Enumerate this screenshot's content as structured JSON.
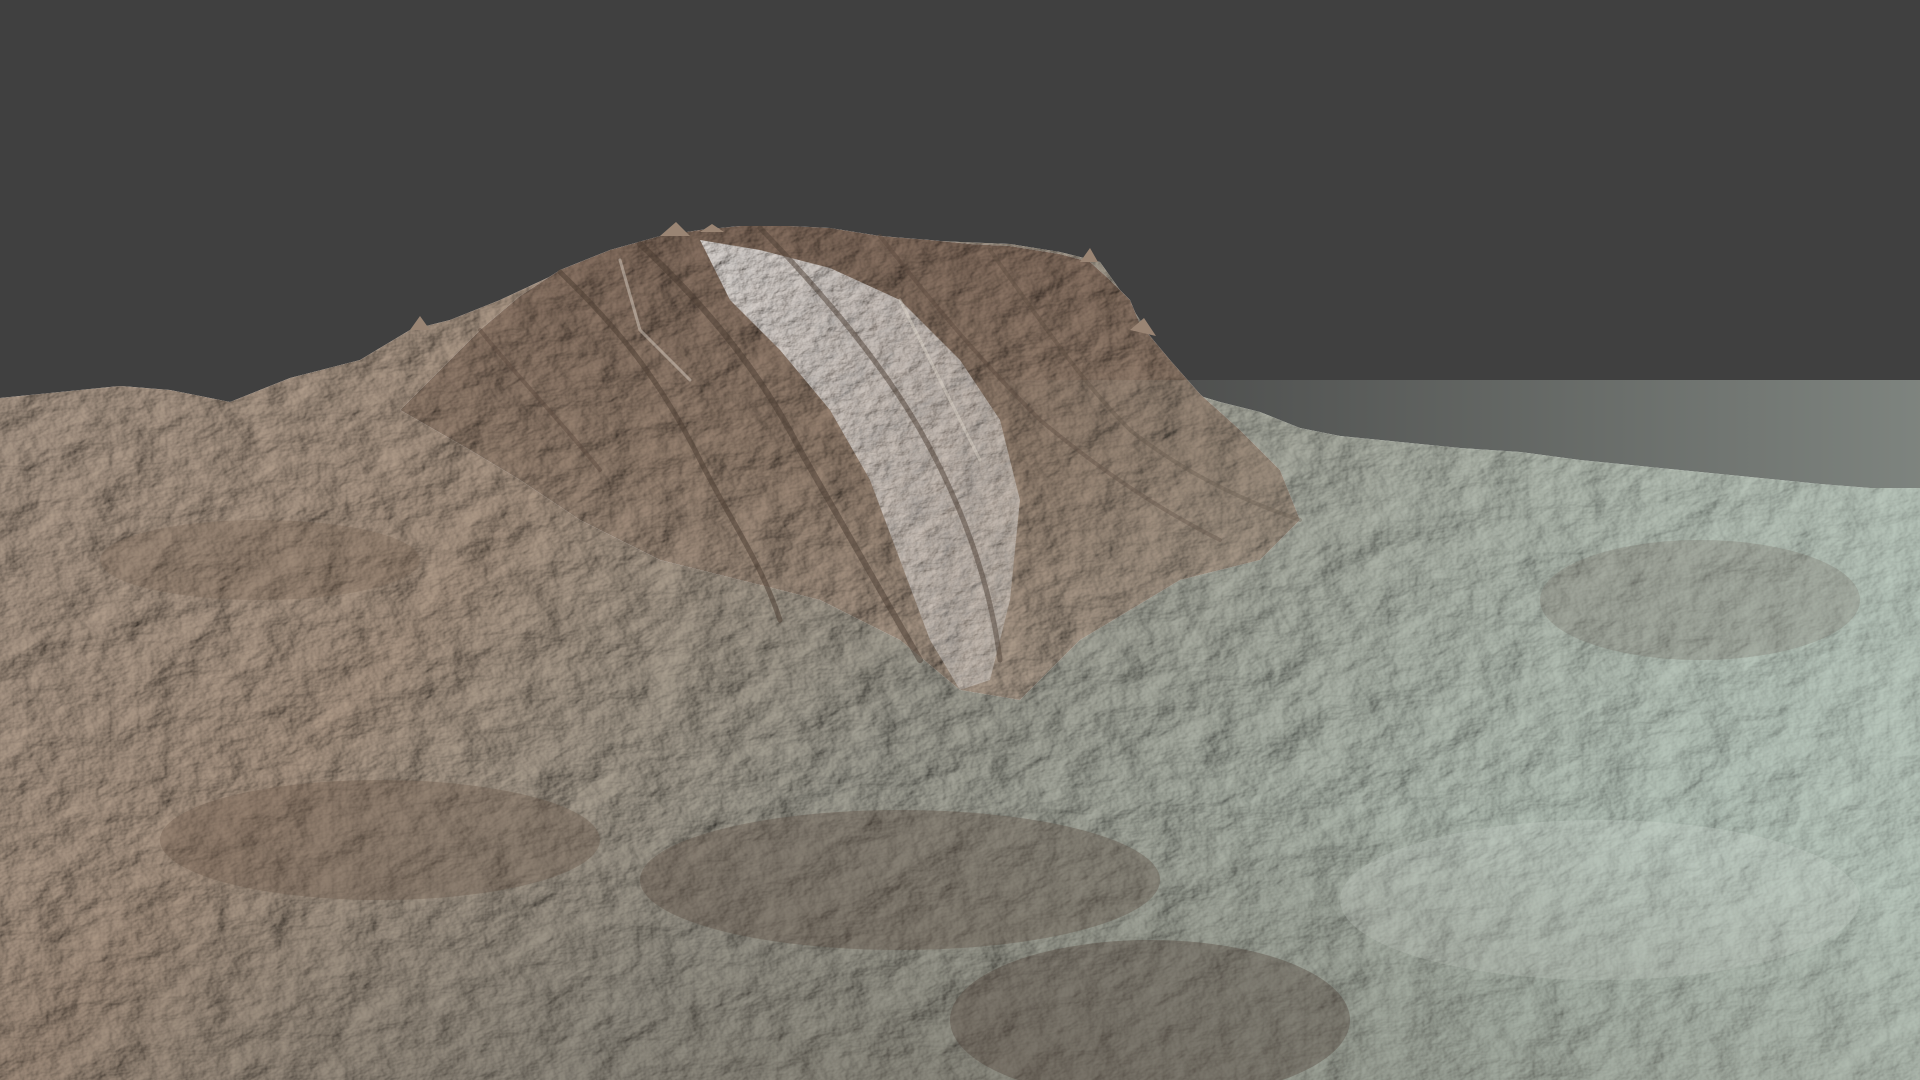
{
  "scene": {
    "kind": "3d-terrain-viewport",
    "background_color": "#404040",
    "terrain_colors": {
      "highlight": "#c8cdc0",
      "light": "#a9ab9f",
      "mid": "#8e8478",
      "warm": "#9c7f6c",
      "shadow": "#5a4a3f",
      "deep_shadow": "#3d3029",
      "teal_tint": "#a9bdb2"
    },
    "visible_text": []
  }
}
